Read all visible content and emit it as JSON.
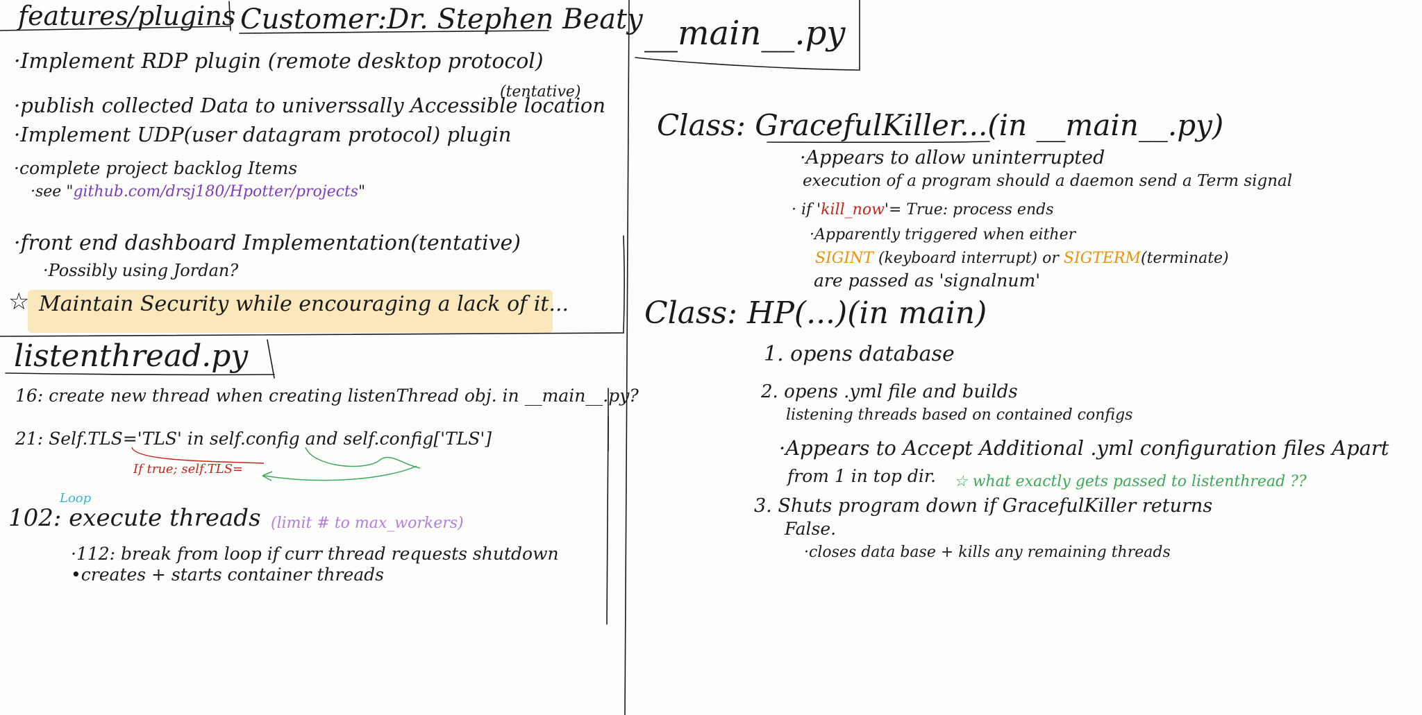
{
  "features": {
    "heading": "features/plugins",
    "customer": "Customer:Dr. Stephen Beaty",
    "items": [
      "·Implement RDP plugin (remote desktop protocol)",
      "·publish collected Data to universsally Accessible location",
      "·Implement UDP(user datagram protocol) plugin",
      "·complete project backlog Items",
      "·front end dashboard Implementation(tentative)",
      "·Possibly using Jordan?",
      "Maintain Security while encouraging a lack of it..."
    ],
    "tentative": "(tentative)",
    "see_prefix": "·see \"",
    "see_link": "github.com/drsj180/Hpotter/projects",
    "see_suffix": "\"",
    "star": "☆"
  },
  "listenthread": {
    "heading": "listenthread.py",
    "line16": "16: create new thread when creating listenThread obj. in __main__.py?",
    "line21": "21: Self.TLS='TLS' in self.config and self.config['TLS']",
    "line21_note": "If true; self.TLS=",
    "loop": "Loop",
    "line102": "102: execute threads",
    "line102_note": "(limit # to max_workers)",
    "line112": "·112: break from loop if curr thread requests shutdown",
    "line_creates": "•creates + starts container threads"
  },
  "main": {
    "heading": "__main__.py",
    "graceful_title": "Class: GracefulKiller...(in __main__.py)",
    "graceful_lines": [
      "·Appears to allow uninterrupted",
      "execution of a program should a daemon send a Term signal"
    ],
    "if_prefix": "· if '",
    "kill_now": "kill_now",
    "if_suffix": "'= True: process ends",
    "triggered": "·Apparently triggered when either",
    "sigint": "SIGINT",
    "kbd": " (keyboard interrupt) or ",
    "sigterm": "SIGTERM",
    "terminate": "(terminate)",
    "passed": "are passed as 'signalnum'",
    "hp_title": "Class: HP(...)(in main)",
    "hp_1": "1. opens database",
    "hp_2a": "2. opens .yml file and builds",
    "hp_2b": "listening threads based on contained configs",
    "hp_2c": "·Appears to Accept Additional .yml configuration files Apart",
    "hp_2d": "from 1 in top dir.",
    "hp_2_q": "☆ what exactly gets passed to listenthread ??",
    "hp_3a": "3. Shuts program down if GracefulKiller returns",
    "hp_3b": "False.",
    "hp_3c": "·closes data base + kills any remaining threads"
  }
}
